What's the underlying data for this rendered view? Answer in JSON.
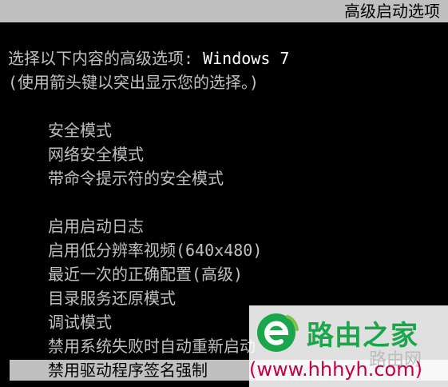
{
  "window": {
    "title": "高级启动选项"
  },
  "prompt": {
    "line1_prefix": "选择以下内容的高级选项: ",
    "line1_os": "Windows 7",
    "line2": "(使用箭头键以突出显示您的选择。)"
  },
  "menu": {
    "group1": [
      {
        "label": "安全模式"
      },
      {
        "label": "网络安全模式"
      },
      {
        "label": "带命令提示符的安全模式"
      }
    ],
    "group2": [
      {
        "label": "启用启动日志"
      },
      {
        "label": "启用低分辨率视频(640x480)"
      },
      {
        "label": "最近一次的正确配置(高级)"
      },
      {
        "label": "目录服务还原模式"
      },
      {
        "label": "调试模式"
      },
      {
        "label": "禁用系统失败时自动重新启动"
      },
      {
        "label": "禁用驱动程序签名强制",
        "selected": true
      }
    ]
  },
  "watermark": {
    "logo_icon": "router-e-logo-icon",
    "name": "路由之家",
    "sub": "路由网",
    "url": "(www.hhhyh.com)",
    "brand_color": "#1aa64a",
    "url_color": "#c8003c"
  },
  "colors": {
    "background": "#000000",
    "text": "#c0c0c0",
    "highlight_text": "#ffffff",
    "bar": "#c0c0c0"
  }
}
